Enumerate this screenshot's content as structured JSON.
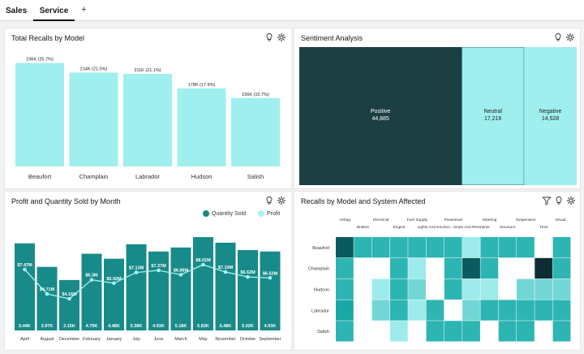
{
  "tabs": [
    {
      "label": "Sales",
      "active": false
    },
    {
      "label": "Service",
      "active": true
    }
  ],
  "add_tab_label": "+",
  "icons": {
    "insight": "lightbulb-icon",
    "settings": "gear-icon",
    "filter": "filter-icon"
  },
  "colors": {
    "bar_light": "#9fefef",
    "bar_teal": "#198a8a",
    "dark_teal": "#1b3f42",
    "profit_line": "#a6f2f2"
  },
  "panels": {
    "recalls_by_model": {
      "title": "Total Recalls by Model"
    },
    "sentiment": {
      "title": "Sentiment Analysis"
    },
    "profit_quantity": {
      "title": "Profit and Quantity Sold by Month",
      "legend": [
        "Quantity Sold",
        "Profit"
      ]
    },
    "recalls_system": {
      "title": "Recalls by Model and System Affected"
    }
  },
  "chart_data": [
    {
      "id": "recalls_by_model",
      "type": "bar",
      "title": "Total Recalls by Model",
      "categories": [
        "Beaufort",
        "Champlain",
        "Labrador",
        "Hudson",
        "Salish"
      ],
      "values": [
        236,
        214,
        211,
        178,
        156
      ],
      "labels": [
        "236K (25.7%)",
        "214K (21.5%)",
        "211K (21.1%)",
        "178K (17.9%)",
        "156K (15.7%)"
      ],
      "ylim": [
        0,
        250
      ]
    },
    {
      "id": "sentiment",
      "type": "treemap",
      "title": "Sentiment Analysis",
      "categories": [
        "Positive",
        "Neutral",
        "Negative"
      ],
      "values": [
        44885,
        17216,
        14528
      ],
      "labels": [
        "44,885",
        "17,216",
        "14,528"
      ]
    },
    {
      "id": "profit_quantity",
      "type": "bar",
      "title": "Profit and Quantity Sold by Month",
      "categories": [
        "April",
        "August",
        "December",
        "February",
        "January",
        "July",
        "June",
        "March",
        "May",
        "November",
        "October",
        "September"
      ],
      "series": [
        {
          "name": "Quantity Sold",
          "type": "bar",
          "values": [
            5.44,
            3.97,
            3.15,
            4.79,
            4.48,
            5.38,
            4.93,
            5.18,
            5.83,
            5.48,
            5.02,
            4.93
          ],
          "labels": [
            "5.44K",
            "3.97K",
            "3.15K",
            "4.79K",
            "4.48K",
            "5.38K",
            "4.93K",
            "5.18K",
            "5.83K",
            "5.48K",
            "5.02K",
            "4.93K"
          ]
        },
        {
          "name": "Profit",
          "type": "line",
          "values": [
            7.47,
            4.71,
            4.16,
            6.3,
            5.92,
            7.13,
            7.37,
            6.88,
            8.01,
            7.19,
            6.62,
            6.52
          ],
          "labels": [
            "$7.47M",
            "$4.71M",
            "$4.16M",
            "$6.3M",
            "$5.92M",
            "$7.13M",
            "$7.37M",
            "$6.88M",
            "$8.01M",
            "$7.19M",
            "$6.62M",
            "$6.52M"
          ]
        }
      ]
    },
    {
      "id": "recalls_system",
      "type": "heatmap",
      "title": "Recalls by Model and System Affected",
      "x": [
        "Airbag",
        "Brakes",
        "Electrical",
        "Engine",
        "Fuel Supply",
        "Lights And Environ...",
        "Powertrain",
        "Seats And Restraints",
        "Steering",
        "Structure",
        "Suspension",
        "Tires",
        "Visual..."
      ],
      "y": [
        "Beaufort",
        "Champlain",
        "Hudson",
        "Labrador",
        "Salish"
      ],
      "values": [
        [
          6,
          3,
          3,
          3,
          3,
          3,
          3,
          1,
          3,
          3,
          3,
          0,
          3
        ],
        [
          3,
          0,
          0,
          3,
          1,
          0,
          3,
          6,
          3,
          0,
          0,
          7,
          3
        ],
        [
          3,
          0,
          1,
          3,
          2,
          0,
          3,
          1,
          1,
          0,
          2,
          2,
          2
        ],
        [
          4,
          0,
          2,
          3,
          1,
          3,
          0,
          2,
          3,
          3,
          3,
          3,
          3
        ],
        [
          3,
          0,
          0,
          1,
          0,
          3,
          3,
          3,
          0,
          3,
          3,
          0,
          3
        ]
      ]
    }
  ]
}
